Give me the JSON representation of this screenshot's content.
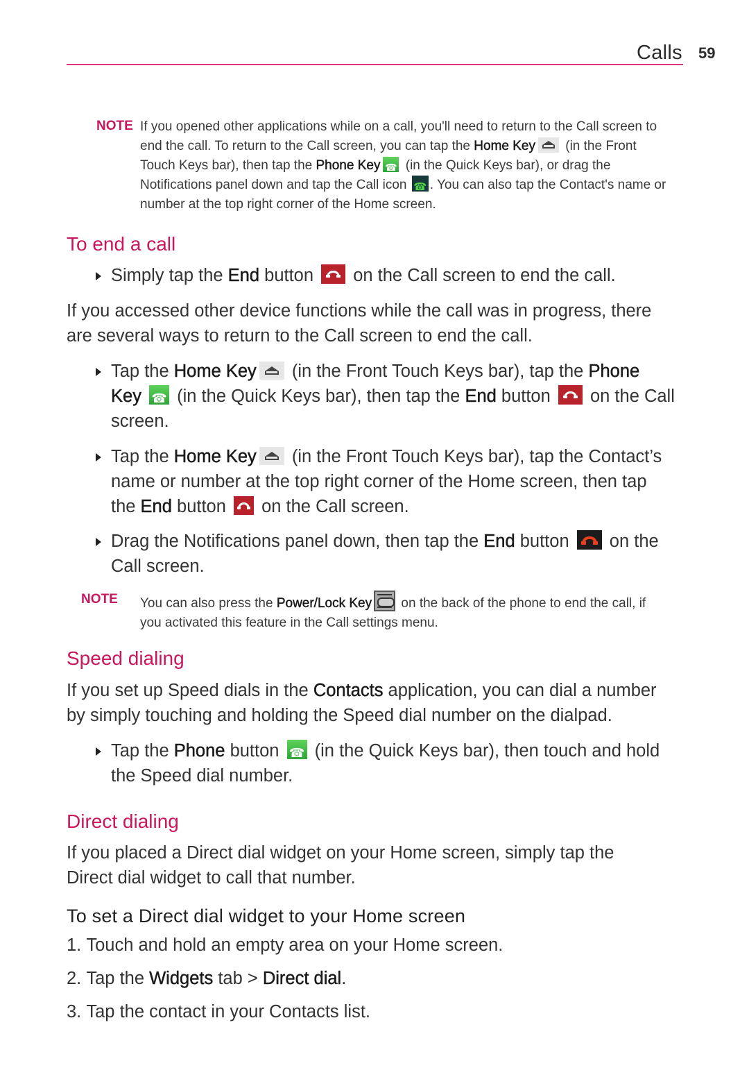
{
  "header": {
    "section": "Calls",
    "page_number": "59",
    "accent_color": "#e0337a"
  },
  "note1": {
    "label": "NOTE",
    "t1": "If you opened other applications while on a call, you'll need to return to the Call screen to",
    "t2a": "end the call. To return to the Call screen, you can tap the ",
    "t2b": "Home Key",
    "t2c": " (in the Front",
    "t3a": "Touch Keys bar), then tap the ",
    "t3b": "Phone Key",
    "t3c": " (in the Quick Keys bar), or drag the",
    "t4a": "Notifications panel down and tap the Call icon ",
    "t4b": ". You can also tap the Contact's name or",
    "t5": "number at the top right corner of the Home screen."
  },
  "end_call": {
    "heading": "To end a call",
    "bullet1": {
      "a": "Simply tap the ",
      "b": "End",
      "c": " button ",
      "d": " on the Call screen to end the call."
    },
    "para": [
      "If you accessed other device functions while the call was in progress, there",
      "are several ways to return to the Call screen to end the call."
    ],
    "bullet2": {
      "l1a": "Tap the ",
      "l1b": "Home Key",
      "l1c": " (in the Front Touch Keys bar), tap the ",
      "l1d": "Phone",
      "l2a": "Key",
      "l2b": " (in the Quick Keys bar), then tap the ",
      "l2c": "End",
      "l2d": " button ",
      "l2e": " on the Call",
      "l3": "screen."
    },
    "bullet3": {
      "l1a": "Tap the ",
      "l1b": "Home Key",
      "l1c": " (in the Front Touch Keys bar), tap the Contact’s",
      "l2": "name or number at the top right corner of the Home screen, then tap",
      "l3a": "the ",
      "l3b": "End",
      "l3c": " button ",
      "l3d": " on the Call screen."
    },
    "bullet4": {
      "l1a": "Drag the Notifications panel down, then tap the ",
      "l1b": "End",
      "l1c": " button ",
      "l1d": " on the",
      "l2": "Call screen."
    }
  },
  "note2": {
    "label": "NOTE",
    "l1a": "You can also press the ",
    "l1b": "Power/Lock Key",
    "l1c": " on the back of the phone to end the call, if",
    "l2": "you activated this feature in the Call settings menu."
  },
  "speed": {
    "heading": "Speed dialing",
    "p1a": "If you set up Speed dials in the ",
    "p1b": "Contacts",
    "p1c": " application, you can dial a number",
    "p2": "by simply touching and holding the Speed dial number on the dialpad.",
    "bullet": {
      "l1a": "Tap the ",
      "l1b": "Phone",
      "l1c": " button ",
      "l1d": " (in the Quick Keys bar), then touch and hold",
      "l2": "the Speed dial number."
    }
  },
  "direct": {
    "heading": "Direct dialing",
    "para": [
      "If you placed a Direct dial widget on your Home screen, simply tap the",
      "Direct dial widget to call that number."
    ],
    "subheading": "To set a Direct dial widget to your Home screen",
    "steps": [
      {
        "n": "1.",
        "a": "Touch and hold an empty area on your Home screen."
      },
      {
        "n": "2.",
        "a": "Tap the ",
        "b": "Widgets",
        "c": " tab > ",
        "d": "Direct dial",
        "e": "."
      },
      {
        "n": "3.",
        "a": "Tap the contact in your Contacts list."
      }
    ]
  }
}
